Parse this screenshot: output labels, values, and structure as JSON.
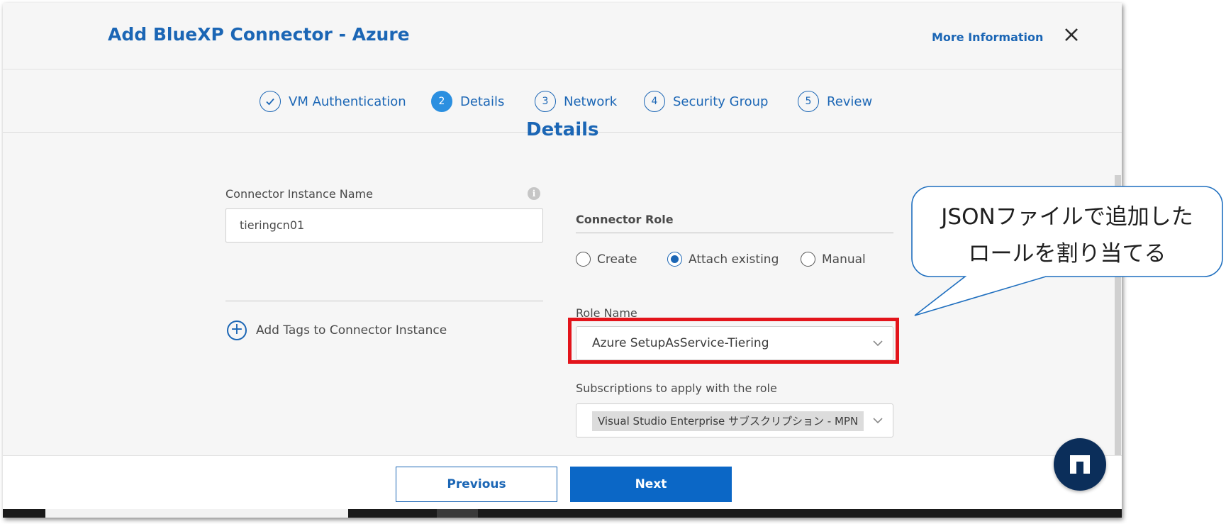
{
  "dialog": {
    "title": "Add BlueXP Connector - Azure",
    "more_information": "More Information"
  },
  "steps": [
    {
      "number": "✓",
      "label": "VM Authentication",
      "state": "completed"
    },
    {
      "number": "2",
      "label": "Details",
      "state": "active"
    },
    {
      "number": "3",
      "label": "Network",
      "state": "pending"
    },
    {
      "number": "4",
      "label": "Security Group",
      "state": "pending"
    },
    {
      "number": "5",
      "label": "Review",
      "state": "pending"
    }
  ],
  "section_title": "Details",
  "connector_instance": {
    "label": "Connector Instance Name",
    "info_glyph": "i",
    "value": "tieringcn01"
  },
  "add_tags": {
    "icon": "+",
    "label": "Add Tags to Connector Instance"
  },
  "connector_role": {
    "heading": "Connector Role",
    "options": [
      {
        "label": "Create",
        "checked": false
      },
      {
        "label": "Attach existing",
        "checked": true
      },
      {
        "label": "Manual",
        "checked": false
      }
    ]
  },
  "role_name": {
    "label": "Role Name",
    "value": "Azure SetupAsService-Tiering"
  },
  "subscriptions": {
    "label": "Subscriptions to apply with the role",
    "selected": "Visual Studio Enterprise サブスクリプション - MPN"
  },
  "footer": {
    "previous_label": "Previous",
    "next_label": "Next"
  },
  "callout": {
    "line1": "JSONファイルで追加した",
    "line2": "ロールを割り当てる"
  },
  "colors": {
    "accent": "#1b66b5",
    "primary_button": "#0b67c6",
    "highlight": "#e3141b",
    "fab": "#0b2e5a"
  },
  "icons": {
    "close": "close-icon",
    "check": "check-icon",
    "chevron": "chevron-down-icon",
    "fab": "netapp-logo-icon"
  }
}
